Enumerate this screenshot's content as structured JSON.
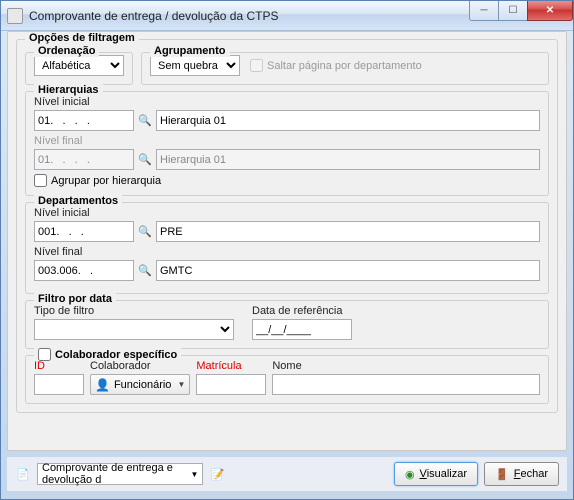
{
  "window": {
    "title": "Comprovante de entrega / devolução da CTPS"
  },
  "filter_section": {
    "legend": "Opções de filtragem",
    "ordenacao": {
      "label": "Ordenação",
      "value": "Alfabética"
    },
    "agrupamento": {
      "label": "Agrupamento",
      "value": "Sem quebra"
    },
    "saltar": {
      "label": "Saltar página por departamento",
      "checked": false
    }
  },
  "hierarquias": {
    "legend": "Hierarquias",
    "nivel_inicial": {
      "label": "Nível inicial",
      "code": "01.   .   .   .",
      "name": "Hierarquia 01"
    },
    "nivel_final": {
      "label": "Nível final",
      "code": "01.   .   .   .",
      "name": "Hierarquia 01"
    },
    "agrupar": {
      "label": "Agrupar por hierarquia",
      "checked": false
    }
  },
  "departamentos": {
    "legend": "Departamentos",
    "nivel_inicial": {
      "label": "Nível inicial",
      "code": "001.   .   .",
      "name": "PRE"
    },
    "nivel_final": {
      "label": "Nível final",
      "code": "003.006.   .",
      "name": "GMTC"
    }
  },
  "filtro_data": {
    "legend": "Filtro por data",
    "tipo": {
      "label": "Tipo de filtro",
      "value": ""
    },
    "referencia": {
      "label": "Data de referência",
      "value": "__/__/____"
    }
  },
  "colaborador": {
    "legend": "Colaborador específico",
    "checked": false,
    "id_label": "ID",
    "colab_label": "Colaborador",
    "colab_value": "Funcionário",
    "matricula_label": "Matrícula",
    "nome_label": "Nome"
  },
  "footer": {
    "report_value": "Comprovante de entrega e devolução d",
    "visualizar": "Visualizar",
    "fechar": "Fechar"
  }
}
